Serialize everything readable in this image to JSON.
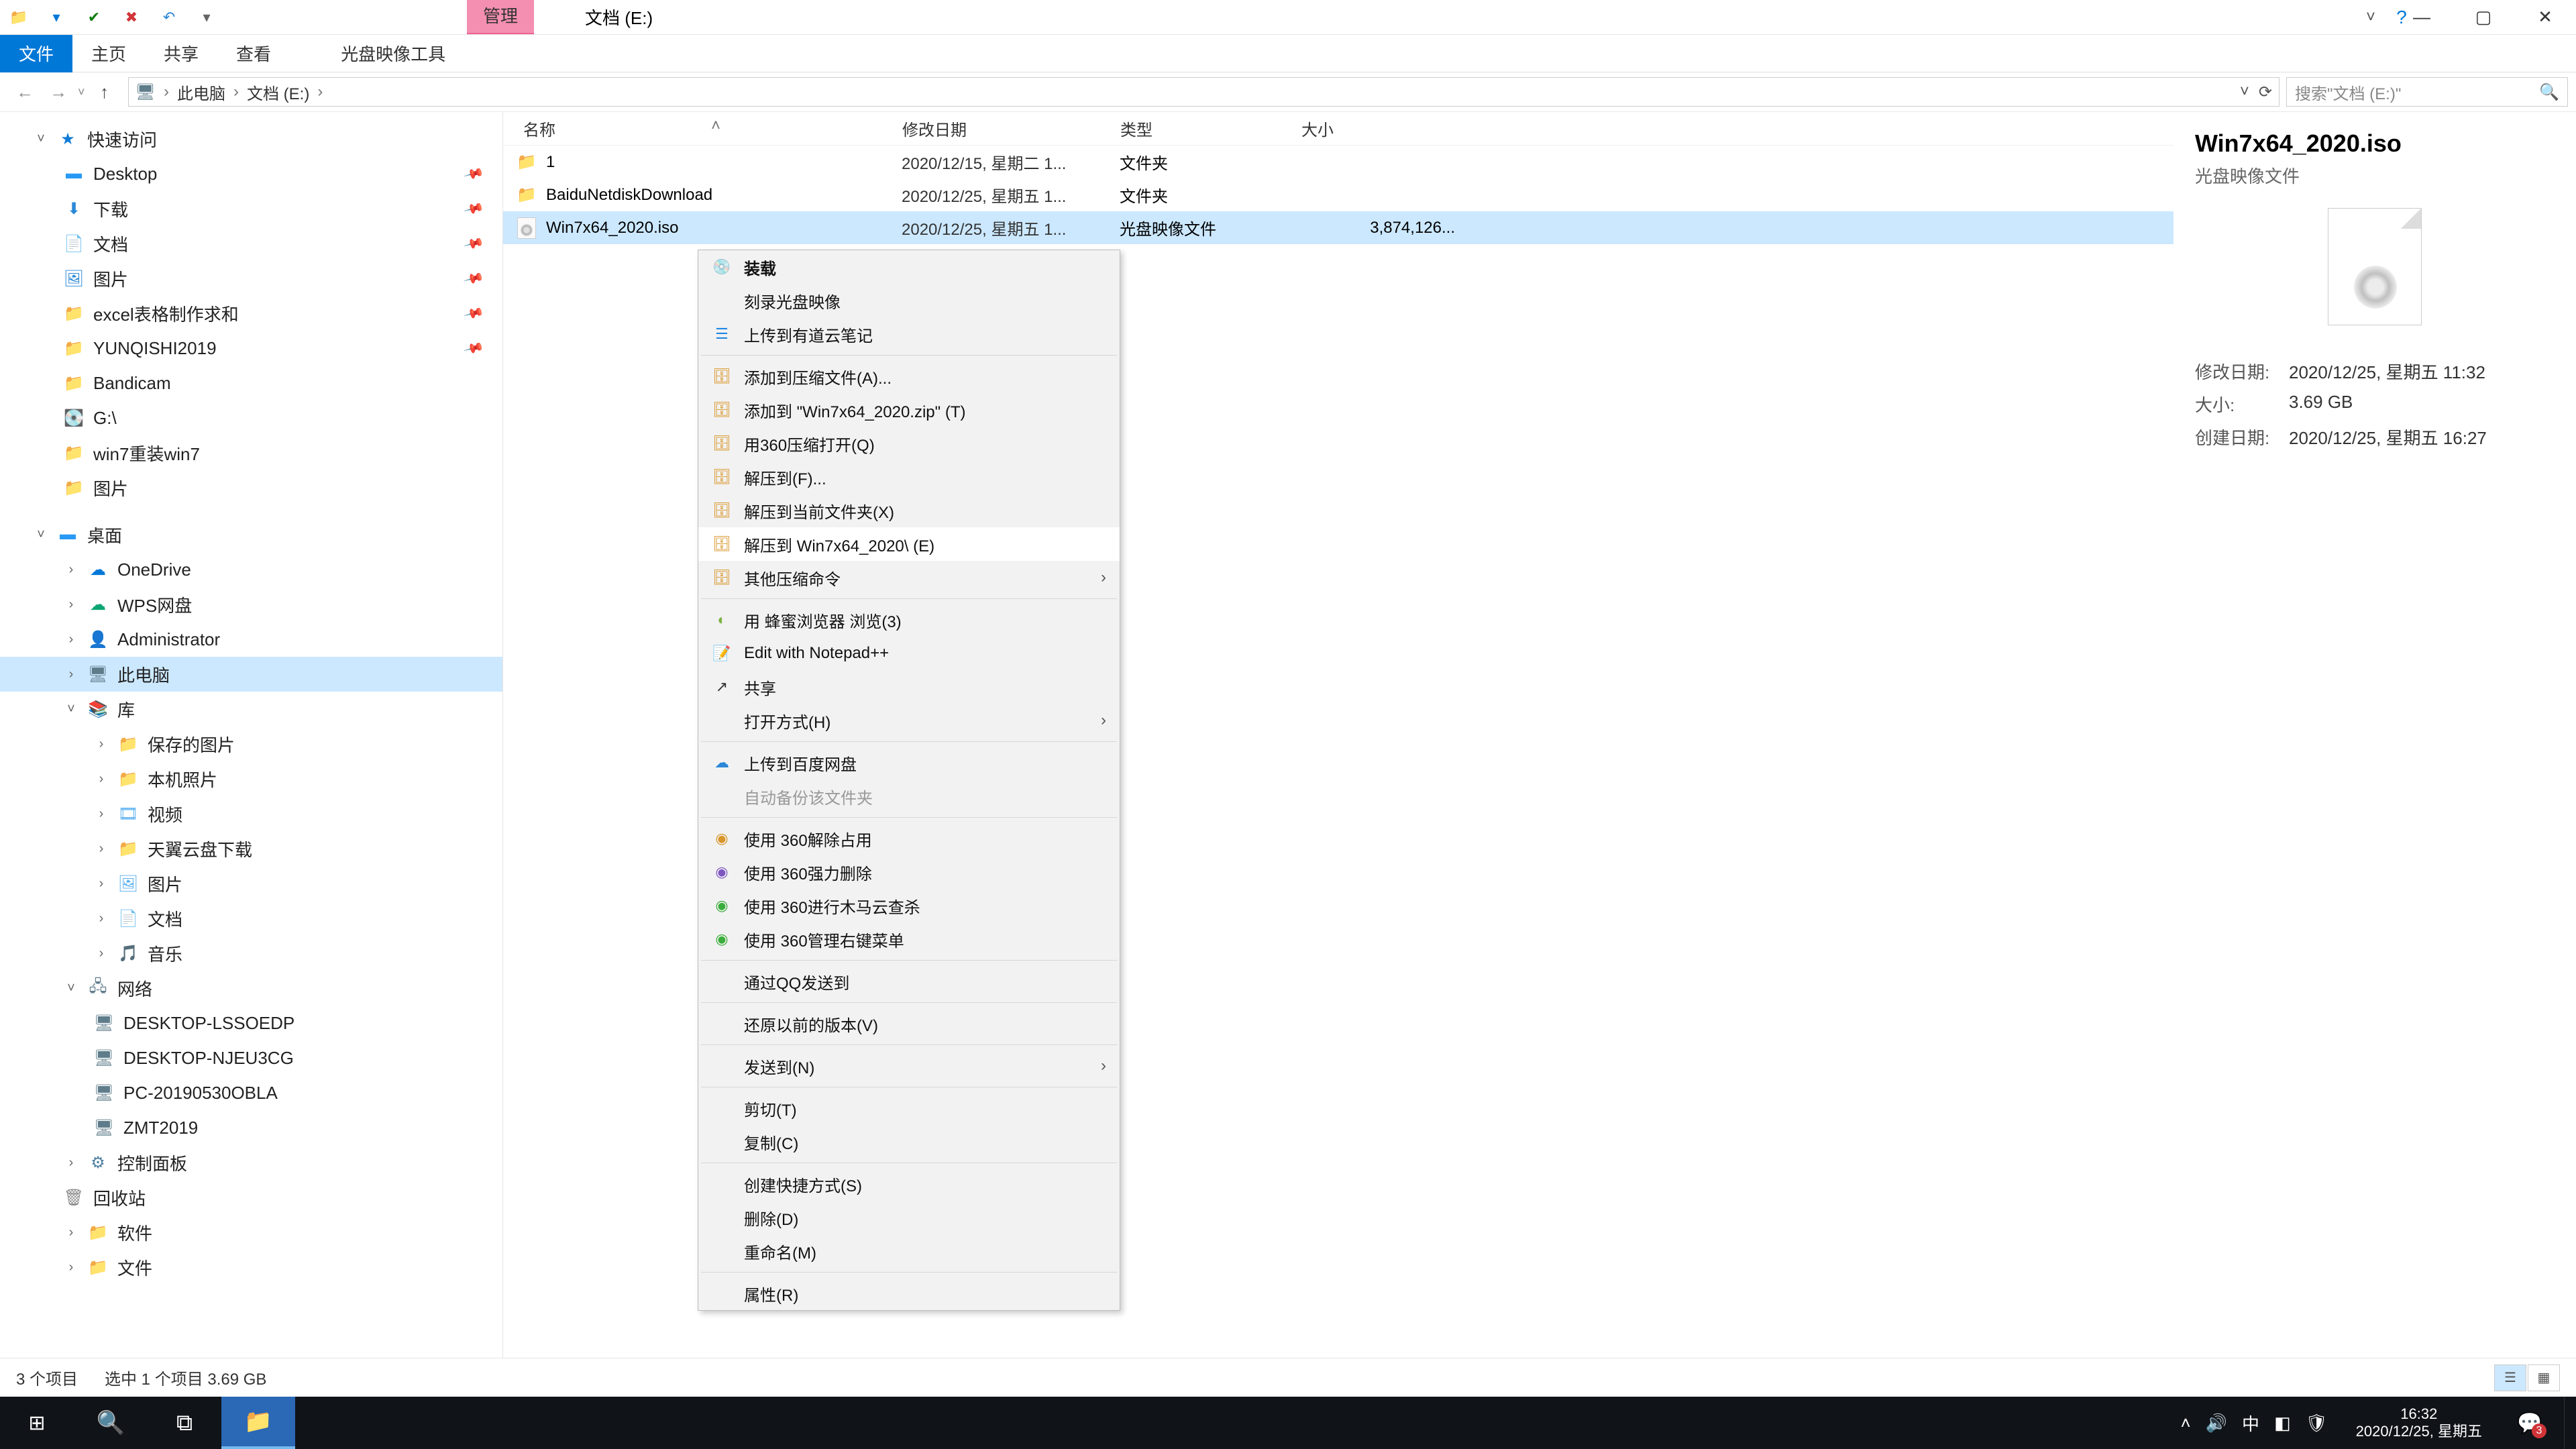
{
  "window": {
    "title_tab_manage": "管理",
    "title_e": "文档 (E:)",
    "ribbon": {
      "file": "文件",
      "home": "主页",
      "share": "共享",
      "view": "查看",
      "image_tools": "光盘映像工具"
    }
  },
  "address": {
    "crumbs": [
      "此电脑",
      "文档 (E:)"
    ],
    "search_placeholder": "搜索\"文档 (E:)\""
  },
  "nav": {
    "quick": "快速访问",
    "items_quick": [
      "Desktop",
      "下载",
      "文档",
      "图片",
      "excel表格制作求和",
      "YUNQISHI2019",
      "Bandicam",
      "G:\\",
      "win7重装win7",
      "图片"
    ],
    "desktop": "桌面",
    "items_desktop": [
      "OneDrive",
      "WPS网盘",
      "Administrator",
      "此电脑",
      "库"
    ],
    "lib_items": [
      "保存的图片",
      "本机照片",
      "视频",
      "天翼云盘下载",
      "图片",
      "文档",
      "音乐"
    ],
    "network": "网络",
    "net_items": [
      "DESKTOP-LSSOEDP",
      "DESKTOP-NJEU3CG",
      "PC-20190530OBLA",
      "ZMT2019"
    ],
    "cp": "控制面板",
    "recycle": "回收站",
    "software": "软件",
    "file": "文件"
  },
  "cols": {
    "name": "名称",
    "date": "修改日期",
    "type": "类型",
    "size": "大小"
  },
  "rows": [
    {
      "name": "1",
      "date": "2020/12/15, 星期二 1...",
      "type": "文件夹",
      "size": ""
    },
    {
      "name": "BaiduNetdiskDownload",
      "date": "2020/12/25, 星期五 1...",
      "type": "文件夹",
      "size": ""
    },
    {
      "name": "Win7x64_2020.iso",
      "date": "2020/12/25, 星期五 1...",
      "type": "光盘映像文件",
      "size": "3,874,126..."
    }
  ],
  "context": {
    "mount": "装载",
    "burn": "刻录光盘映像",
    "ynote": "上传到有道云笔记",
    "add_archive": "添加到压缩文件(A)...",
    "add_zip": "添加到 \"Win7x64_2020.zip\" (T)",
    "open_360": "用360压缩打开(Q)",
    "extract_to": "解压到(F)...",
    "extract_here": "解压到当前文件夹(X)",
    "extract_folder": "解压到 Win7x64_2020\\ (E)",
    "other_compress": "其他压缩命令",
    "bee_browser": "用 蜂蜜浏览器 浏览(3)",
    "npp": "Edit with Notepad++",
    "share": "共享",
    "open_with": "打开方式(H)",
    "baidu_upload": "上传到百度网盘",
    "auto_backup": "自动备份该文件夹",
    "use_360_release": "使用 360解除占用",
    "use_360_force": "使用 360强力删除",
    "use_360_scan": "使用 360进行木马云查杀",
    "use_360_menu": "使用 360管理右键菜单",
    "qq_send": "通过QQ发送到",
    "restore": "还原以前的版本(V)",
    "send_to": "发送到(N)",
    "cut": "剪切(T)",
    "copy": "复制(C)",
    "shortcut": "创建快捷方式(S)",
    "delete": "删除(D)",
    "rename": "重命名(M)",
    "props": "属性(R)"
  },
  "preview": {
    "title": "Win7x64_2020.iso",
    "subtitle": "光盘映像文件",
    "label_modified": "修改日期:",
    "val_modified": "2020/12/25, 星期五 11:32",
    "label_size": "大小:",
    "val_size": "3.69 GB",
    "label_created": "创建日期:",
    "val_created": "2020/12/25, 星期五 16:27"
  },
  "status": {
    "count": "3 个项目",
    "selected": "选中 1 个项目  3.69 GB"
  },
  "taskbar": {
    "lang": "中",
    "time": "16:32",
    "date": "2020/12/25, 星期五",
    "badge": "3"
  }
}
